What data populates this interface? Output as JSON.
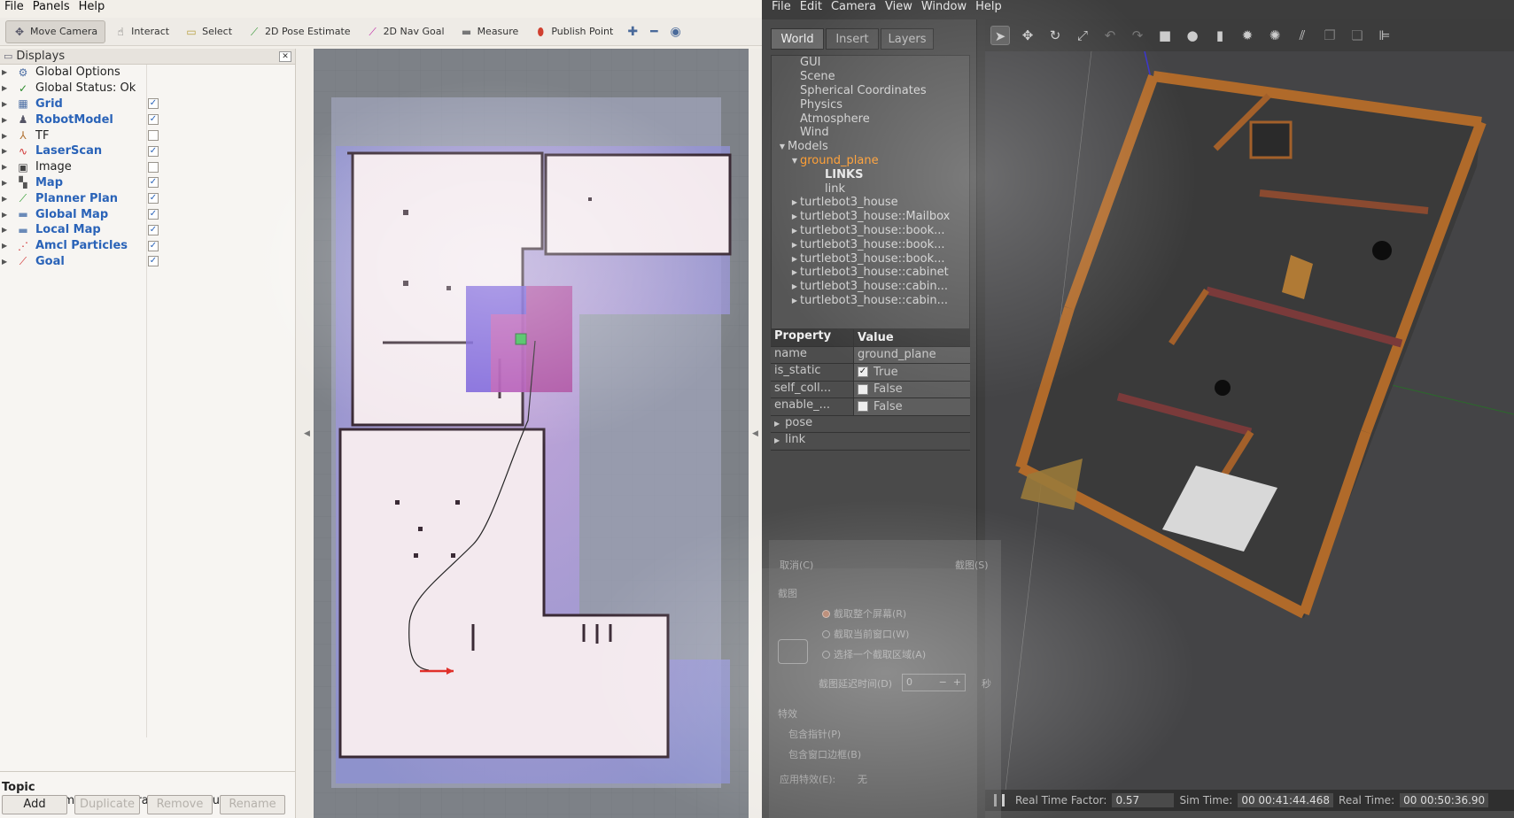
{
  "rviz": {
    "menu": [
      "File",
      "Panels",
      "Help"
    ],
    "tools": [
      {
        "label": "Move Camera",
        "icon": "move-camera-icon"
      },
      {
        "label": "Interact",
        "icon": "hand-icon"
      },
      {
        "label": "Select",
        "icon": "select-box-icon"
      },
      {
        "label": "2D Pose Estimate",
        "icon": "green-arrow-icon"
      },
      {
        "label": "2D Nav Goal",
        "icon": "magenta-arrow-icon"
      },
      {
        "label": "Measure",
        "icon": "ruler-icon"
      },
      {
        "label": "Publish Point",
        "icon": "pin-icon"
      }
    ],
    "displays_title": "Displays",
    "displays": [
      {
        "label": "Global Options",
        "checked": null,
        "icon": "gear-icon",
        "blue": false
      },
      {
        "label": "Global Status: Ok",
        "checked": null,
        "icon": "check-icon",
        "blue": false
      },
      {
        "label": "Grid",
        "checked": true,
        "icon": "grid-icon",
        "blue": true
      },
      {
        "label": "RobotModel",
        "checked": true,
        "icon": "robot-icon",
        "blue": true
      },
      {
        "label": "TF",
        "checked": false,
        "icon": "tf-icon",
        "blue": false
      },
      {
        "label": "LaserScan",
        "checked": true,
        "icon": "laser-icon",
        "blue": true
      },
      {
        "label": "Image",
        "checked": false,
        "icon": "image-icon",
        "blue": false
      },
      {
        "label": "Map",
        "checked": true,
        "icon": "map-icon",
        "blue": true
      },
      {
        "label": "Planner Plan",
        "checked": true,
        "icon": "path-icon",
        "blue": true
      },
      {
        "label": "Global Map",
        "checked": true,
        "icon": "folder-icon",
        "blue": true
      },
      {
        "label": "Local Map",
        "checked": true,
        "icon": "folder-icon",
        "blue": true
      },
      {
        "label": "Amcl Particles",
        "checked": true,
        "icon": "particles-icon",
        "blue": true
      },
      {
        "label": "Goal",
        "checked": true,
        "icon": "goal-icon",
        "blue": true
      }
    ],
    "description": {
      "title": "Topic",
      "text": "geometry_msgs/PoseArray topic to subscribe to."
    },
    "buttons": [
      {
        "label": "Add",
        "enabled": true
      },
      {
        "label": "Duplicate",
        "enabled": false
      },
      {
        "label": "Remove",
        "enabled": false
      },
      {
        "label": "Rename",
        "enabled": false
      }
    ]
  },
  "gazebo": {
    "menu": [
      "File",
      "Edit",
      "Camera",
      "View",
      "Window",
      "Help"
    ],
    "tabs": [
      "World",
      "Insert",
      "Layers"
    ],
    "tree": [
      {
        "label": "GUI",
        "level": 1,
        "arrow": "",
        "style": ""
      },
      {
        "label": "Scene",
        "level": 1,
        "arrow": "",
        "style": ""
      },
      {
        "label": "Spherical Coordinates",
        "level": 1,
        "arrow": "",
        "style": ""
      },
      {
        "label": "Physics",
        "level": 1,
        "arrow": "",
        "style": ""
      },
      {
        "label": "Atmosphere",
        "level": 1,
        "arrow": "",
        "style": ""
      },
      {
        "label": "Wind",
        "level": 1,
        "arrow": "",
        "style": ""
      },
      {
        "label": "Models",
        "level": 0,
        "arrow": "down",
        "style": ""
      },
      {
        "label": "ground_plane",
        "level": 1,
        "arrow": "down",
        "style": "sel"
      },
      {
        "label": "LINKS",
        "level": 3,
        "arrow": "",
        "style": "bold"
      },
      {
        "label": "link",
        "level": 3,
        "arrow": "",
        "style": ""
      },
      {
        "label": "turtlebot3_house",
        "level": 1,
        "arrow": "right",
        "style": ""
      },
      {
        "label": "turtlebot3_house::Mailbox",
        "level": 1,
        "arrow": "right",
        "style": ""
      },
      {
        "label": "turtlebot3_house::book...",
        "level": 1,
        "arrow": "right",
        "style": ""
      },
      {
        "label": "turtlebot3_house::book...",
        "level": 1,
        "arrow": "right",
        "style": ""
      },
      {
        "label": "turtlebot3_house::book...",
        "level": 1,
        "arrow": "right",
        "style": ""
      },
      {
        "label": "turtlebot3_house::cabinet",
        "level": 1,
        "arrow": "right",
        "style": ""
      },
      {
        "label": "turtlebot3_house::cabin...",
        "level": 1,
        "arrow": "right",
        "style": ""
      },
      {
        "label": "turtlebot3_house::cabin...",
        "level": 1,
        "arrow": "right",
        "style": ""
      }
    ],
    "property_header": {
      "key": "Property",
      "value": "Value"
    },
    "properties": [
      {
        "key": "name",
        "value": "ground_plane",
        "checkbox": null
      },
      {
        "key": "is_static",
        "value": "True",
        "checkbox": true
      },
      {
        "key": "self_coll...",
        "value": "False",
        "checkbox": false
      },
      {
        "key": "enable_...",
        "value": "False",
        "checkbox": false
      }
    ],
    "expandables": [
      "pose",
      "link"
    ],
    "status": {
      "rtf_label": "Real Time Factor:",
      "rtf": "0.57",
      "sim_label": "Sim Time:",
      "sim": "00 00:41:44.468",
      "real_label": "Real Time:",
      "real": "00 00:50:36.90"
    }
  },
  "screenshot_dialog": {
    "cancel": "取消(C)",
    "capture": "截图(S)",
    "section": "截图",
    "options": [
      "截取整个屏幕(R)",
      "截取当前窗口(W)",
      "选择一个截取区域(A)"
    ],
    "delay_label": "截图延迟时间(D)",
    "delay_value": "0",
    "delay_unit": "秒",
    "effects": "特效",
    "effect_options": [
      "包含指针(P)",
      "包含窗口边框(B)"
    ],
    "apply_effects": "应用特效(E):",
    "apply_value": "无"
  }
}
